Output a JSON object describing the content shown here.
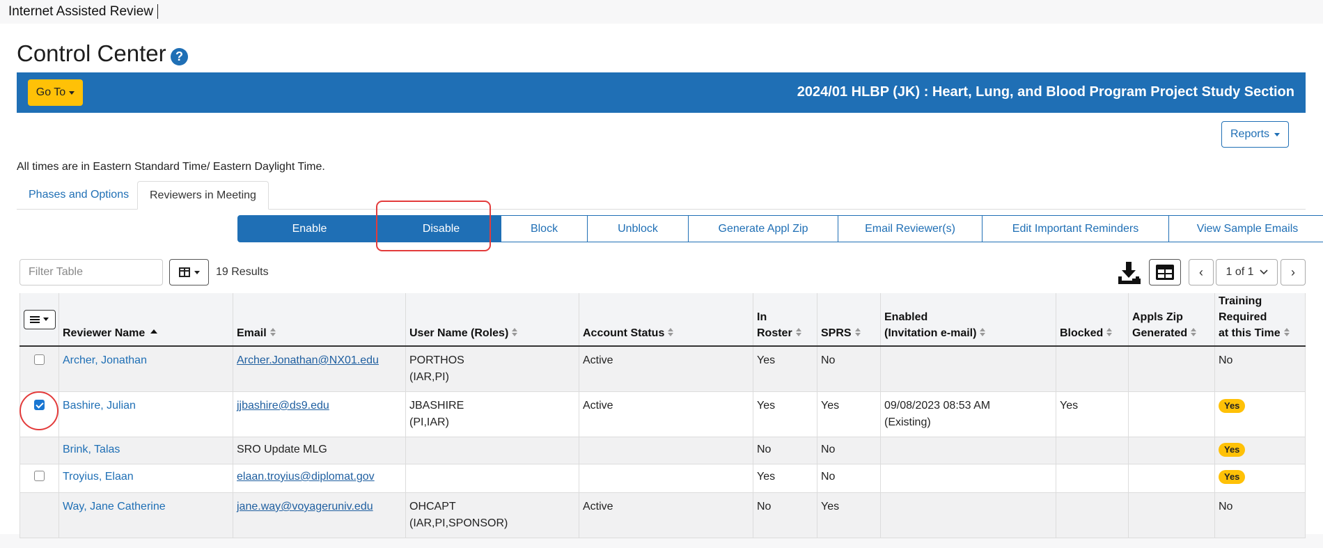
{
  "app": {
    "title": "Internet Assisted Review"
  },
  "page": {
    "title": "Control Center",
    "help_icon": "question-circle-icon"
  },
  "banner": {
    "goto_label": "Go To",
    "meeting_title": "2024/01 HLBP (JK) : Heart, Lung, and Blood Program Project Study Section",
    "color": "#1f6fb5"
  },
  "reports_label": "Reports",
  "tz_note": "All times are in Eastern Standard Time/ Eastern Daylight Time.",
  "tabs": [
    {
      "label": "Phases and Options",
      "active": false
    },
    {
      "label": "Reviewers in Meeting",
      "active": true
    }
  ],
  "actions": [
    "Enable",
    "Disable",
    "Block",
    "Unblock",
    "Generate Appl Zip",
    "Email Reviewer(s)",
    "Edit Important Reminders",
    "View Sample Emails"
  ],
  "toolbar": {
    "filter_placeholder": "Filter Table",
    "results": "19 Results",
    "page": "1 of 1",
    "download_icon": "download-icon",
    "grid_icon": "grid-view-icon"
  },
  "table": {
    "headers": [
      "Reviewer Name",
      "Email",
      "User Name (Roles)",
      "Account Status",
      "In Roster",
      "SPRS",
      "Enabled (Invitation e-mail)",
      "Blocked",
      "Appls Zip Generated",
      "Training Required at this Time"
    ],
    "header_lines": {
      "in_roster": [
        "In",
        "Roster"
      ],
      "enabled": [
        "Enabled",
        "(Invitation e-mail)"
      ],
      "zip": [
        "Appls Zip",
        "Generated"
      ],
      "training": [
        "Training Required",
        "at this Time"
      ]
    },
    "rows": [
      {
        "checkbox": "unchecked",
        "name": "Archer, Jonathan",
        "email": "Archer.Jonathan@NX01.edu",
        "email_link": true,
        "user": "PORTHOS",
        "roles": "(IAR,PI)",
        "status": "Active",
        "roster": "Yes",
        "sprs": "No",
        "enabled": "",
        "enabled_note": "",
        "blocked": "",
        "zip": "",
        "training": "No",
        "training_badge": false
      },
      {
        "checkbox": "checked",
        "name": "Bashire, Julian",
        "email": "jjbashire@ds9.edu",
        "email_link": true,
        "user": "JBASHIRE",
        "roles": "(PI,IAR)",
        "status": "Active",
        "roster": "Yes",
        "sprs": "Yes",
        "enabled": "09/08/2023 08:53 AM",
        "enabled_note": "(Existing)",
        "blocked": "Yes",
        "zip": "",
        "training": "Yes",
        "training_badge": true
      },
      {
        "checkbox": "none",
        "name": "Brink, Talas",
        "email": "SRO Update MLG",
        "email_link": false,
        "user": "",
        "roles": "",
        "status": "",
        "roster": "No",
        "sprs": "No",
        "enabled": "",
        "enabled_note": "",
        "blocked": "",
        "zip": "",
        "training": "Yes",
        "training_badge": true
      },
      {
        "checkbox": "unchecked",
        "name": "Troyius, Elaan",
        "email": "elaan.troyius@diplomat.gov",
        "email_link": true,
        "user": "",
        "roles": "",
        "status": "",
        "roster": "Yes",
        "sprs": "No",
        "enabled": "",
        "enabled_note": "",
        "blocked": "",
        "zip": "",
        "training": "Yes",
        "training_badge": true
      },
      {
        "checkbox": "none",
        "name": "Way, Jane Catherine",
        "email": "jane.way@voyageruniv.edu",
        "email_link": true,
        "user": "OHCAPT",
        "roles": "(IAR,PI,SPONSOR)",
        "status": "Active",
        "roster": "No",
        "sprs": "Yes",
        "enabled": "",
        "enabled_note": "",
        "blocked": "",
        "zip": "",
        "training": "No",
        "training_badge": false
      }
    ]
  },
  "colors": {
    "primary": "#1f6fb5",
    "accent": "#ffc107",
    "highlight": "#e33b3b"
  }
}
